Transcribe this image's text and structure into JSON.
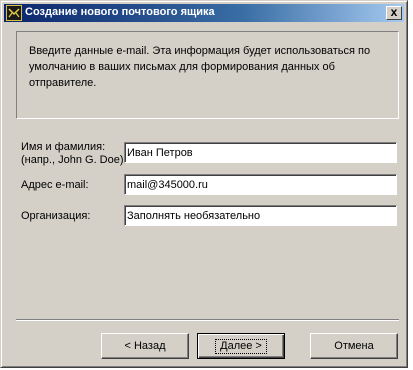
{
  "window": {
    "title": "Создание нового почтового ящика",
    "close_label": "x",
    "titlebar_color": "#0a246a"
  },
  "info": {
    "text": "Введите данные e-mail. Эта информация будет использоваться по умолчанию в ваших письмах для формирования данных об отправителе."
  },
  "form": {
    "name_label_line1": "Имя и фамилия:",
    "name_label_line2": "(напр., John G. Doe)",
    "name_value": "Иван Петров",
    "email_label": "Адрес e-mail:",
    "email_value": "mail@345000.ru",
    "org_label": "Организация:",
    "org_value": "Заполнять необязательно"
  },
  "buttons": {
    "back": "<  Назад",
    "next": "Далее  >",
    "cancel": "Отмена"
  },
  "icons": {
    "app_icon": "mailbox-icon",
    "close_icon": "close-icon"
  }
}
